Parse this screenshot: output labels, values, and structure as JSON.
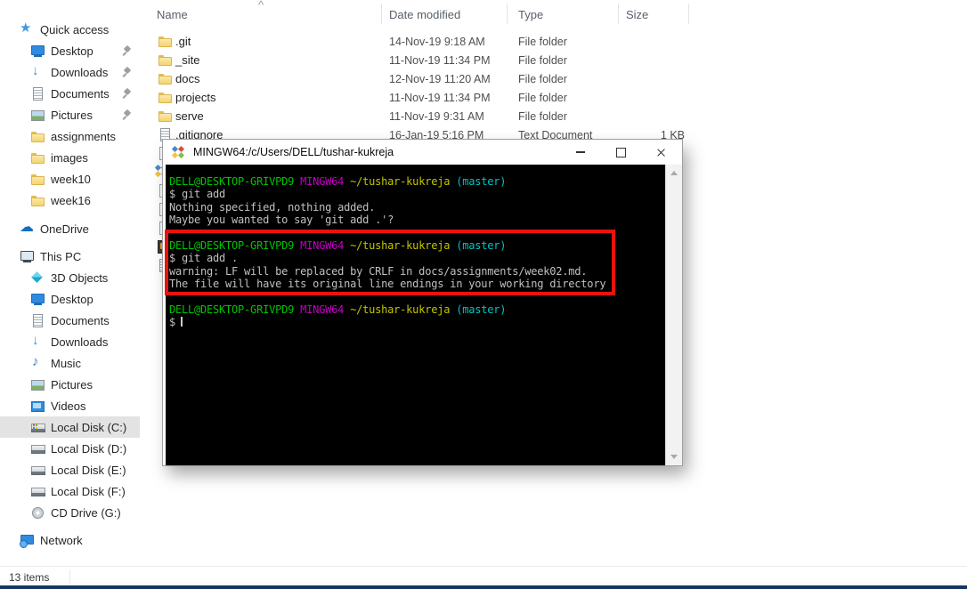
{
  "explorer": {
    "sidebar": {
      "items": [
        {
          "label": "Quick access"
        },
        {
          "label": "Desktop"
        },
        {
          "label": "Downloads"
        },
        {
          "label": "Documents"
        },
        {
          "label": "Pictures"
        },
        {
          "label": "assignments"
        },
        {
          "label": "images"
        },
        {
          "label": "week10"
        },
        {
          "label": "week16"
        },
        {
          "label": "OneDrive"
        },
        {
          "label": "This PC"
        },
        {
          "label": "3D Objects"
        },
        {
          "label": "Desktop"
        },
        {
          "label": "Documents"
        },
        {
          "label": "Downloads"
        },
        {
          "label": "Music"
        },
        {
          "label": "Pictures"
        },
        {
          "label": "Videos"
        },
        {
          "label": "Local Disk (C:)"
        },
        {
          "label": "Local Disk (D:)"
        },
        {
          "label": "Local Disk (E:)"
        },
        {
          "label": "Local Disk (F:)"
        },
        {
          "label": "CD Drive (G:)"
        },
        {
          "label": "Network"
        }
      ],
      "selected": "Local Disk (C:)"
    },
    "columns": {
      "name": "Name",
      "date": "Date modified",
      "type": "Type",
      "size": "Size",
      "sort_indicator": "^"
    },
    "files": [
      {
        "name": ".git",
        "date": "14-Nov-19 9:18 AM",
        "type": "File folder",
        "size": ""
      },
      {
        "name": "_site",
        "date": "11-Nov-19 11:34 PM",
        "type": "File folder",
        "size": ""
      },
      {
        "name": "docs",
        "date": "12-Nov-19 11:20 AM",
        "type": "File folder",
        "size": ""
      },
      {
        "name": "projects",
        "date": "11-Nov-19 11:34 PM",
        "type": "File folder",
        "size": ""
      },
      {
        "name": "serve",
        "date": "11-Nov-19 9:31 AM",
        "type": "File folder",
        "size": ""
      },
      {
        "name": ".gitignore",
        "date": "16-Jan-19 5:16 PM",
        "type": "Text Document",
        "size": "1 KB"
      }
    ],
    "status": "13 items"
  },
  "terminal": {
    "title": "MINGW64:/c/Users/DELL/tushar-kukreja",
    "prompt": {
      "user": "DELL@DESKTOP-GRIVPD9",
      "host": "MINGW64",
      "path": "~/tushar-kukreja",
      "branch": "(master)"
    },
    "blocks": [
      {
        "command": "$ git add",
        "output": [
          "Nothing specified, nothing added.",
          "Maybe you wanted to say 'git add .'?"
        ]
      },
      {
        "command": "$ git add .",
        "output": [
          "warning: LF will be replaced by CRLF in docs/assignments/week02.md.",
          "The file will have its original line endings in your working directory"
        ]
      },
      {
        "command": "$",
        "output": []
      }
    ],
    "colors": {
      "background": "#000000",
      "foreground": "#c0c0c0",
      "user_green": "#00c400",
      "host_magenta": "#c400c4",
      "path_yellow": "#c4c400",
      "branch_cyan": "#00c4c4"
    }
  },
  "annotation": {
    "highlight_color": "#e9130d"
  },
  "icons": {
    "quick-access-icon": "star",
    "desktop-icon": "monitor",
    "downloads-icon": "down-arrow",
    "documents-icon": "lined-document",
    "pictures-icon": "landscape-photo",
    "folder-icon": "yellow-folder",
    "onedrive-icon": "cloud",
    "this-pc-icon": "computer-monitor",
    "3d-objects-icon": "cube",
    "music-icon": "eighth-note",
    "videos-icon": "film-frame",
    "local-disk-icon": "hard-drive",
    "cd-drive-icon": "optical-disc",
    "network-icon": "networked-monitor",
    "pin-icon": "push-pin",
    "mingw-logo-icon": "four-color-diamond"
  }
}
